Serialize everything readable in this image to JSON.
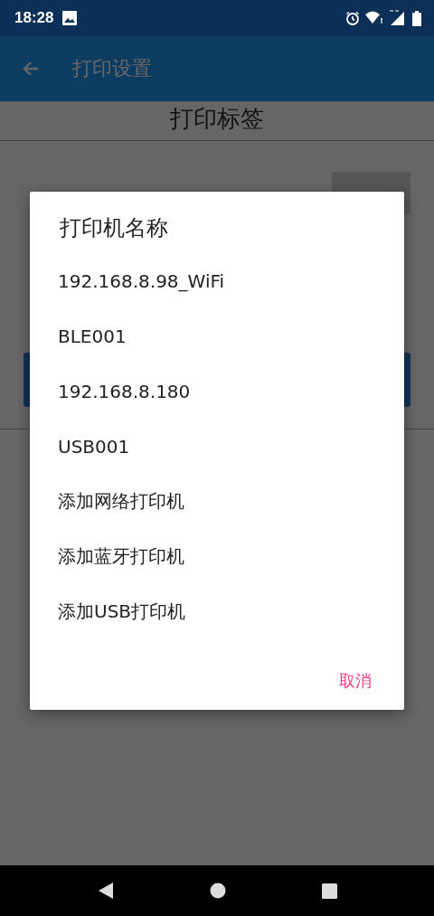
{
  "status_bar": {
    "time": "18:28"
  },
  "app_bar": {
    "title": "打印设置"
  },
  "page": {
    "heading": "打印标签"
  },
  "dialog": {
    "title": "打印机名称",
    "items": [
      "192.168.8.98_WiFi",
      "BLE001",
      "192.168.8.180",
      "USB001",
      "添加网络打印机",
      "添加蓝牙打印机",
      "添加USB打印机"
    ],
    "cancel": "取消"
  }
}
